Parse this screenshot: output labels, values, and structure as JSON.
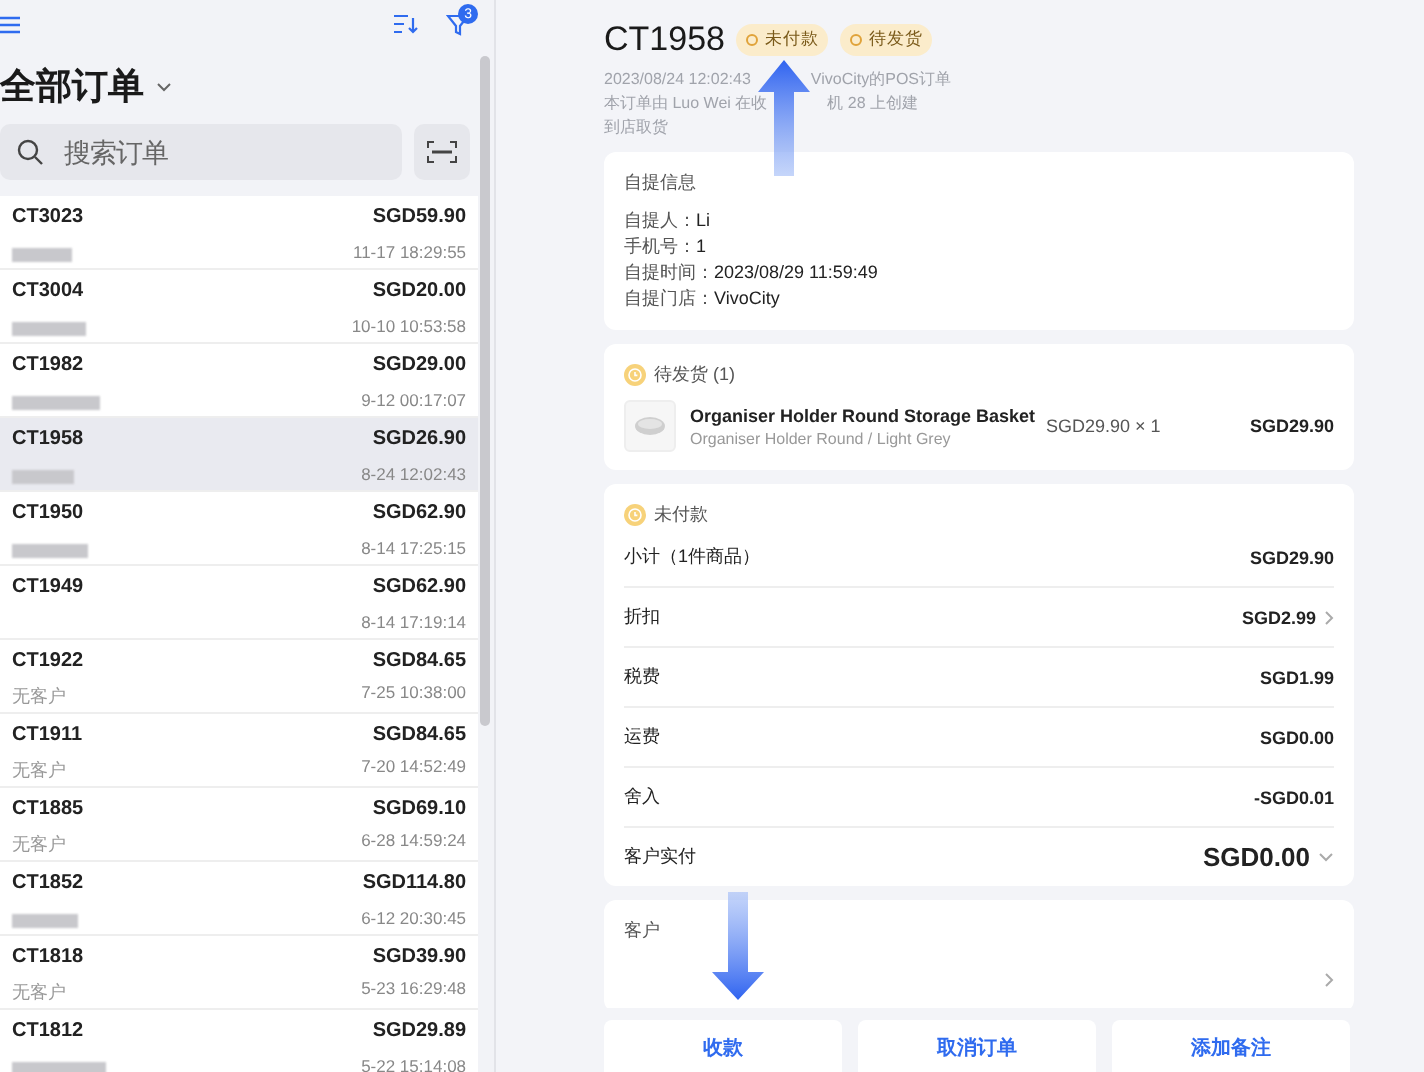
{
  "sidebar": {
    "title": "全部订单",
    "filter_badge": "3",
    "search": {
      "placeholder": "搜索订单"
    },
    "orders": [
      {
        "id": "CT3023",
        "amount": "SGD59.90",
        "time": "11-17 18:29:55",
        "customer": {
          "kind": "redacted"
        },
        "selected": false
      },
      {
        "id": "CT3004",
        "amount": "SGD20.00",
        "time": "10-10 10:53:58",
        "customer": {
          "kind": "redacted"
        },
        "selected": false
      },
      {
        "id": "CT1982",
        "amount": "SGD29.00",
        "time": "9-12 00:17:07",
        "customer": {
          "kind": "redacted"
        },
        "selected": false
      },
      {
        "id": "CT1958",
        "amount": "SGD26.90",
        "time": "8-24 12:02:43",
        "customer": {
          "kind": "redacted"
        },
        "selected": true
      },
      {
        "id": "CT1950",
        "amount": "SGD62.90",
        "time": "8-14 17:25:15",
        "customer": {
          "kind": "redacted"
        },
        "selected": false
      },
      {
        "id": "CT1949",
        "amount": "SGD62.90",
        "time": "8-14 17:19:14",
        "customer": {
          "kind": "empty"
        },
        "selected": false
      },
      {
        "id": "CT1922",
        "amount": "SGD84.65",
        "time": "7-25 10:38:00",
        "customer": {
          "kind": "text",
          "text": "无客户"
        },
        "selected": false
      },
      {
        "id": "CT1911",
        "amount": "SGD84.65",
        "time": "7-20 14:52:49",
        "customer": {
          "kind": "text",
          "text": "无客户"
        },
        "selected": false
      },
      {
        "id": "CT1885",
        "amount": "SGD69.10",
        "time": "6-28 14:59:24",
        "customer": {
          "kind": "text",
          "text": "无客户"
        },
        "selected": false
      },
      {
        "id": "CT1852",
        "amount": "SGD114.80",
        "time": "6-12 20:30:45",
        "customer": {
          "kind": "redacted"
        },
        "selected": false
      },
      {
        "id": "CT1818",
        "amount": "SGD39.90",
        "time": "5-23 16:29:48",
        "customer": {
          "kind": "text",
          "text": "无客户"
        },
        "selected": false
      },
      {
        "id": "CT1812",
        "amount": "SGD29.89",
        "time": "5-22 15:14:08",
        "customer": {
          "kind": "redacted"
        },
        "selected": false
      }
    ]
  },
  "detail": {
    "title": "CT1958",
    "badges": [
      "未付款",
      "待发货"
    ],
    "meta": [
      [
        "2023/08/24 12:02:43",
        "VivoCity的POS订单"
      ],
      [
        "本订单由 Luo Wei 在收",
        "机 28 上创建"
      ],
      [
        "到店取货"
      ]
    ],
    "pickup": {
      "title": "自提信息",
      "fields": [
        {
          "label": "自提人：",
          "value": "Li"
        },
        {
          "label": "手机号：",
          "value": "1"
        },
        {
          "label": "自提时间：",
          "value": "2023/08/29 11:59:49"
        },
        {
          "label": "自提门店：",
          "value": "VivoCity"
        }
      ]
    },
    "shipment": {
      "title": "待发货 (1)",
      "items": [
        {
          "name": "Organiser Holder Round Storage Basket",
          "variant": "Organiser Holder Round / Light Grey",
          "unit_price": "SGD29.90 × 1",
          "total": "SGD29.90"
        }
      ]
    },
    "payment": {
      "title": "未付款",
      "rows": [
        {
          "kind": "plain",
          "label": "小计（1件商品）",
          "value": "SGD29.90",
          "emphasis": false
        },
        {
          "kind": "link",
          "label": "折扣",
          "value": "SGD2.99",
          "emphasis": false
        },
        {
          "kind": "plain",
          "label": "税费",
          "value": "SGD1.99",
          "emphasis": false
        },
        {
          "kind": "plain",
          "label": "运费",
          "value": "SGD0.00",
          "emphasis": false
        },
        {
          "kind": "plain",
          "label": "舍入",
          "value": "-SGD0.01",
          "emphasis": false
        },
        {
          "kind": "dropdown",
          "label": "客户实付",
          "value": "SGD0.00",
          "emphasis": true
        }
      ]
    },
    "customer": {
      "title": "客户"
    },
    "actions": [
      "收款",
      "取消订单",
      "添加备注"
    ]
  }
}
